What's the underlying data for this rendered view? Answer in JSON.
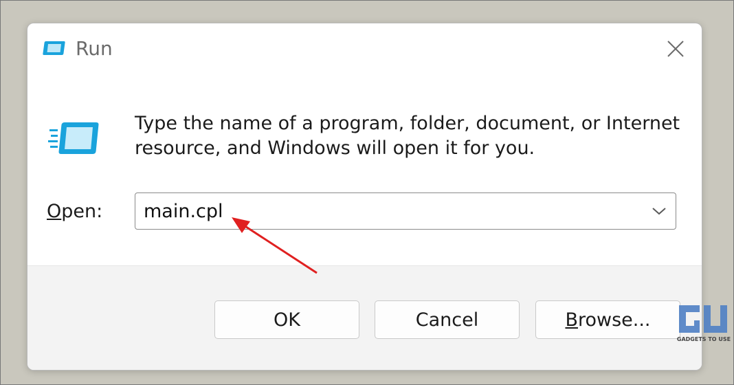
{
  "window": {
    "title": "Run",
    "title_icon": "run-icon",
    "close_icon": "close-icon"
  },
  "dialog": {
    "main_icon": "run-icon",
    "description": "Type the name of a program, folder, document, or Internet resource, and Windows will open it for you.",
    "open_label_accel": "O",
    "open_label_rest": "pen:",
    "open_value": "main.cpl",
    "dropdown_icon": "chevron-down-icon"
  },
  "buttons": {
    "ok_label": "OK",
    "cancel_label": "Cancel",
    "browse_accel": "B",
    "browse_rest": "rowse..."
  },
  "annotation": {
    "arrow_color": "#e02020"
  },
  "watermark": {
    "logo_text": "GU",
    "caption": "GADGETS TO USE"
  },
  "colors": {
    "accent_icon": "#1aa3dc",
    "background": "#c9c7bd",
    "footer": "#f3f3f3"
  }
}
